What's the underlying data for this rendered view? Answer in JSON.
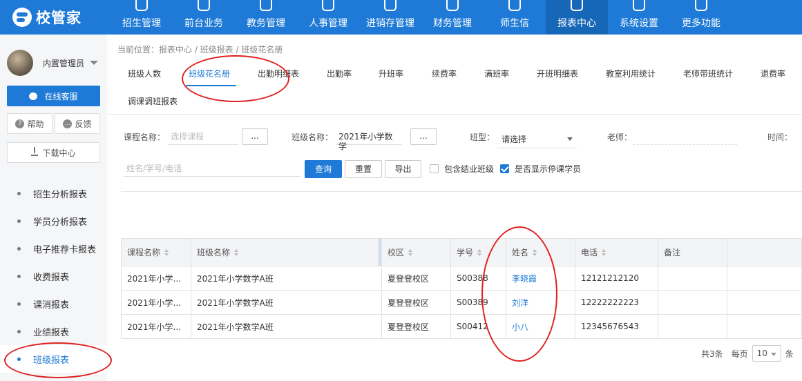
{
  "brand": "校管家",
  "nav": [
    {
      "label": "招生管理",
      "icon": "person-add-icon"
    },
    {
      "label": "前台业务",
      "icon": "document-icon"
    },
    {
      "label": "教务管理",
      "icon": "book-icon"
    },
    {
      "label": "人事管理",
      "icon": "person-icon"
    },
    {
      "label": "进销存管理",
      "icon": "transfer-icon"
    },
    {
      "label": "财务管理",
      "icon": "yen-shield-icon"
    },
    {
      "label": "师生信",
      "icon": "chat-icon"
    },
    {
      "label": "报表中心",
      "icon": "chart-icon",
      "active": true
    },
    {
      "label": "系统设置",
      "icon": "gear-icon"
    },
    {
      "label": "更多功能",
      "icon": "more-icon"
    }
  ],
  "sidebar": {
    "user_name": "内置管理员",
    "service_label": "在线客服",
    "help_label": "帮助",
    "feedback_label": "反馈",
    "download_label": "下载中心",
    "items": [
      {
        "label": "招生分析报表"
      },
      {
        "label": "学员分析报表"
      },
      {
        "label": "电子推荐卡报表"
      },
      {
        "label": "收费报表"
      },
      {
        "label": "课消报表"
      },
      {
        "label": "业绩报表"
      },
      {
        "label": "班级报表",
        "active": true
      }
    ]
  },
  "breadcrumb": "当前位置：报表中心 / 班级报表 / 班级花名册",
  "tabs": [
    {
      "label": "班级人数"
    },
    {
      "label": "班级花名册",
      "active": true
    },
    {
      "label": "出勤明细表"
    },
    {
      "label": "出勤率"
    },
    {
      "label": "升班率"
    },
    {
      "label": "续费率"
    },
    {
      "label": "满班率"
    },
    {
      "label": "开班明细表"
    },
    {
      "label": "教室利用统计"
    },
    {
      "label": "老师带班统计"
    },
    {
      "label": "退费率"
    },
    {
      "label": "调课调班报表"
    }
  ],
  "filters": {
    "course_label": "课程名称：",
    "course_placeholder": "选择课程",
    "dots": "...",
    "class_label": "班级名称：",
    "class_value": "2021年小学数学",
    "type_label": "班型：",
    "type_value": "请选择",
    "teacher_label": "老师：",
    "time_label": "时间：",
    "search_placeholder": "姓名/学号/电话",
    "query_button": "查询",
    "reset_button": "重置",
    "export_button": "导出",
    "include_finished": "包含结业班级",
    "include_finished_checked": false,
    "show_paused": "是否显示停课学员",
    "show_paused_checked": true
  },
  "table": {
    "headers": [
      "课程名称",
      "班级名称",
      "校区",
      "学号",
      "姓名",
      "电话",
      "备注"
    ],
    "rows": [
      [
        "2021年小学...",
        "2021年小学数学A班",
        "夏登登校区",
        "S00388",
        "李晓霞",
        "12121212120",
        ""
      ],
      [
        "2021年小学...",
        "2021年小学数学A班",
        "夏登登校区",
        "S00389",
        "刘洋",
        "12222222223",
        ""
      ],
      [
        "2021年小学...",
        "2021年小学数学A班",
        "夏登登校区",
        "S00412",
        "小八",
        "12345676543",
        ""
      ]
    ]
  },
  "pager": {
    "total": "共3条",
    "per_page_label": "每页",
    "per_page": "10",
    "unit": "条"
  },
  "colors": {
    "primary": "#1e7ad6",
    "annotation": "#e02020"
  }
}
